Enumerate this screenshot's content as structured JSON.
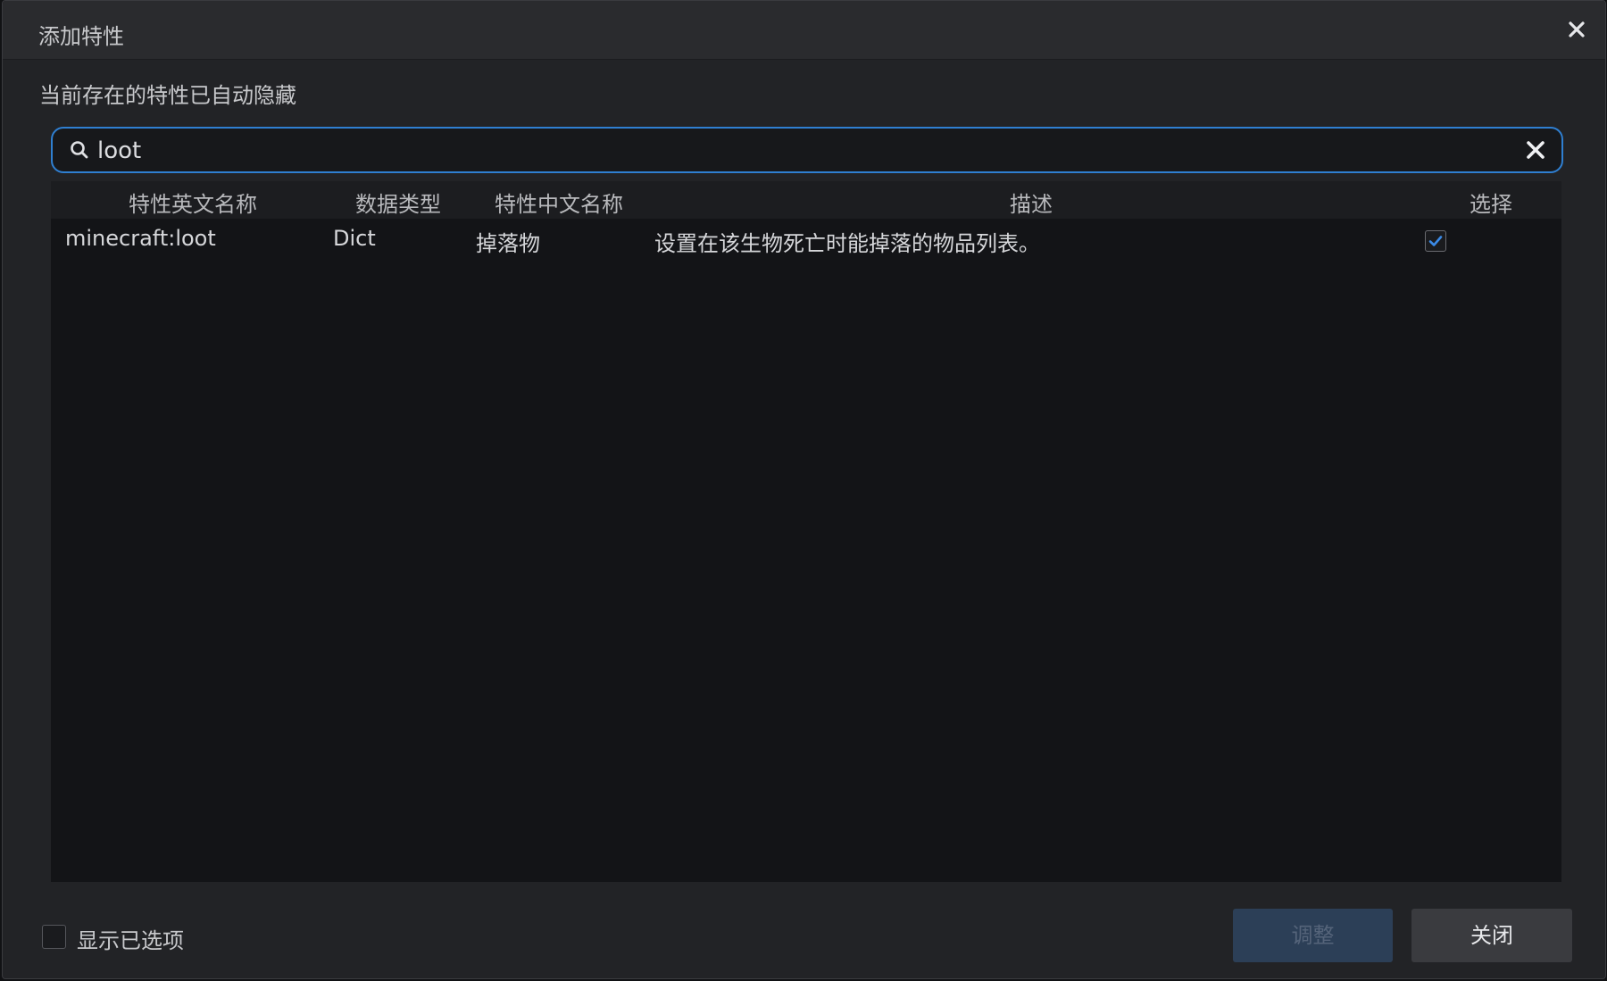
{
  "dialog": {
    "title": "添加特性",
    "hint": "当前存在的特性已自动隐藏"
  },
  "search": {
    "value": "loot",
    "placeholder": ""
  },
  "table": {
    "columns": [
      "特性英文名称",
      "数据类型",
      "特性中文名称",
      "描述",
      "选择"
    ],
    "rows": [
      {
        "name": "minecraft:loot",
        "type": "Dict",
        "cn_name": "掉落物",
        "description": "设置在该生物死亡时能掉落的物品列表。",
        "selected": true
      }
    ]
  },
  "footer": {
    "show_selected_label": "显示已选项",
    "show_selected_checked": false,
    "adjust_label": "调整",
    "close_label": "关闭"
  },
  "colors": {
    "accent": "#2f7fd1",
    "check": "#3b8ae6",
    "background": "#222326"
  },
  "icons": {
    "close": "close-icon",
    "search": "search-icon",
    "clear": "clear-icon",
    "check": "checkmark-icon"
  }
}
